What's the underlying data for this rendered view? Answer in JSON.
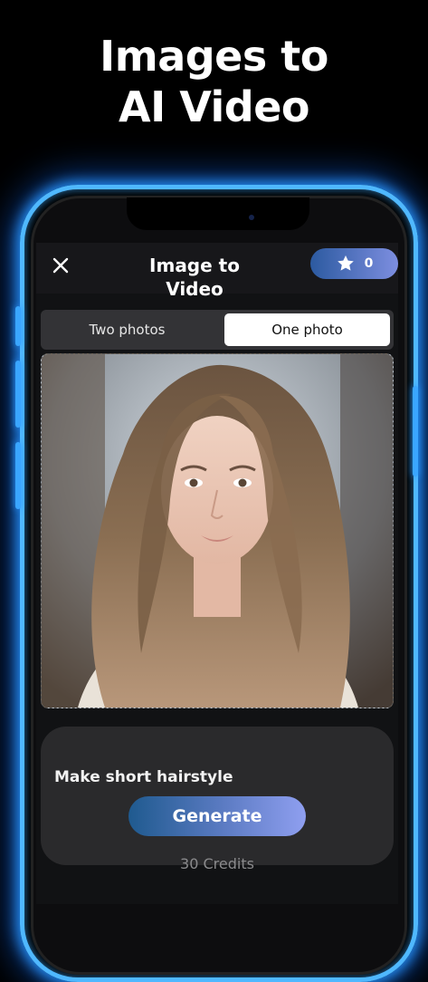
{
  "promo": {
    "line1": "Images to",
    "line2": "AI Video"
  },
  "header": {
    "title": "Image to Video",
    "credits_count": "0",
    "close_icon": "close-icon",
    "credits_icon": "star-badge-icon"
  },
  "segment": {
    "options": [
      "Two photos",
      "One photo"
    ],
    "selected": "One photo"
  },
  "photo": {
    "description_icon": "portrait-image"
  },
  "prompt": {
    "text": "Make short hairstyle",
    "generate_label": "Generate",
    "cost_label": "30 Credits"
  },
  "colors": {
    "neon_glow": "#4fb8ff",
    "pill_start": "#2c5aa0",
    "pill_end": "#7d8ee0",
    "generate_start": "#1f5a8f",
    "generate_end": "#8f9ff0"
  }
}
